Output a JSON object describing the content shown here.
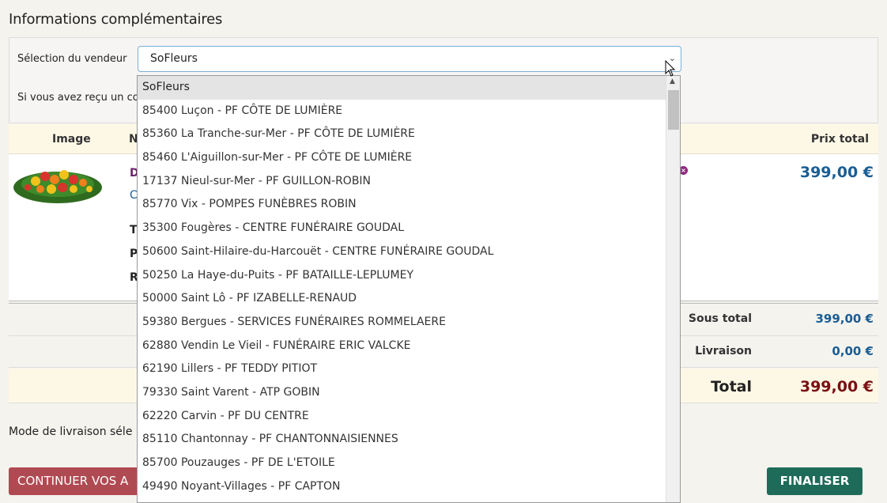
{
  "section": {
    "title": "Informations complémentaires"
  },
  "vendor": {
    "label": "Sélection du vendeur",
    "selected": "SoFleurs"
  },
  "info": {
    "text_partial": "Si vous avez reçu un co"
  },
  "table": {
    "col_image": "Image",
    "col_name_partial": "N",
    "col_total": "Prix total"
  },
  "product": {
    "letters": [
      "D",
      "C",
      "T",
      "P",
      "R"
    ],
    "price": "399,00 €"
  },
  "summary": {
    "subtotal_label": "Sous total",
    "subtotal_value": "399,00 €",
    "delivery_label": "Livraison",
    "delivery_value": "0,00 €",
    "total_label": "Total",
    "total_value": "399,00 €"
  },
  "delivery_mode": {
    "text_partial": "Mode de livraison séle"
  },
  "buttons": {
    "continue_partial": "CONTINUER VOS A",
    "finish": "FINALISER"
  },
  "dropdown": {
    "options": [
      "SoFleurs",
      "85400 Luçon - PF CÔTE DE LUMIÈRE",
      "85360 La Tranche-sur-Mer - PF CÔTE DE LUMIÈRE",
      "85460 L'Aiguillon-sur-Mer - PF CÔTE DE LUMIÈRE",
      "17137 Nieul-sur-Mer - PF GUILLON-ROBIN",
      "85770 Vix - POMPES FUNÈBRES ROBIN",
      "35300 Fougères - CENTRE FUNÉRAIRE GOUDAL",
      "50600 Saint-Hilaire-du-Harcouët - CENTRE FUNÉRAIRE GOUDAL",
      "50250 La Haye-du-Puits - PF BATAILLE-LEPLUMEY",
      "50000 Saint Lô - PF IZABELLE-RENAUD",
      "59380 Bergues - SERVICES FUNÉRAIRES ROMMELAERE",
      "62880 Vendin Le Vieil - FUNÉRAIRE ERIC VALCKE",
      "62190 Lillers - PF TEDDY PITIOT",
      "79330 Saint Varent - ATP GOBIN",
      "62220 Carvin - PF DU CENTRE",
      "85110 Chantonnay - PF CHANTONNAISIENNES",
      "85700 Pouzauges - PF DE L'ETOILE",
      "49490 Noyant-Villages - PF CAPTON"
    ]
  }
}
